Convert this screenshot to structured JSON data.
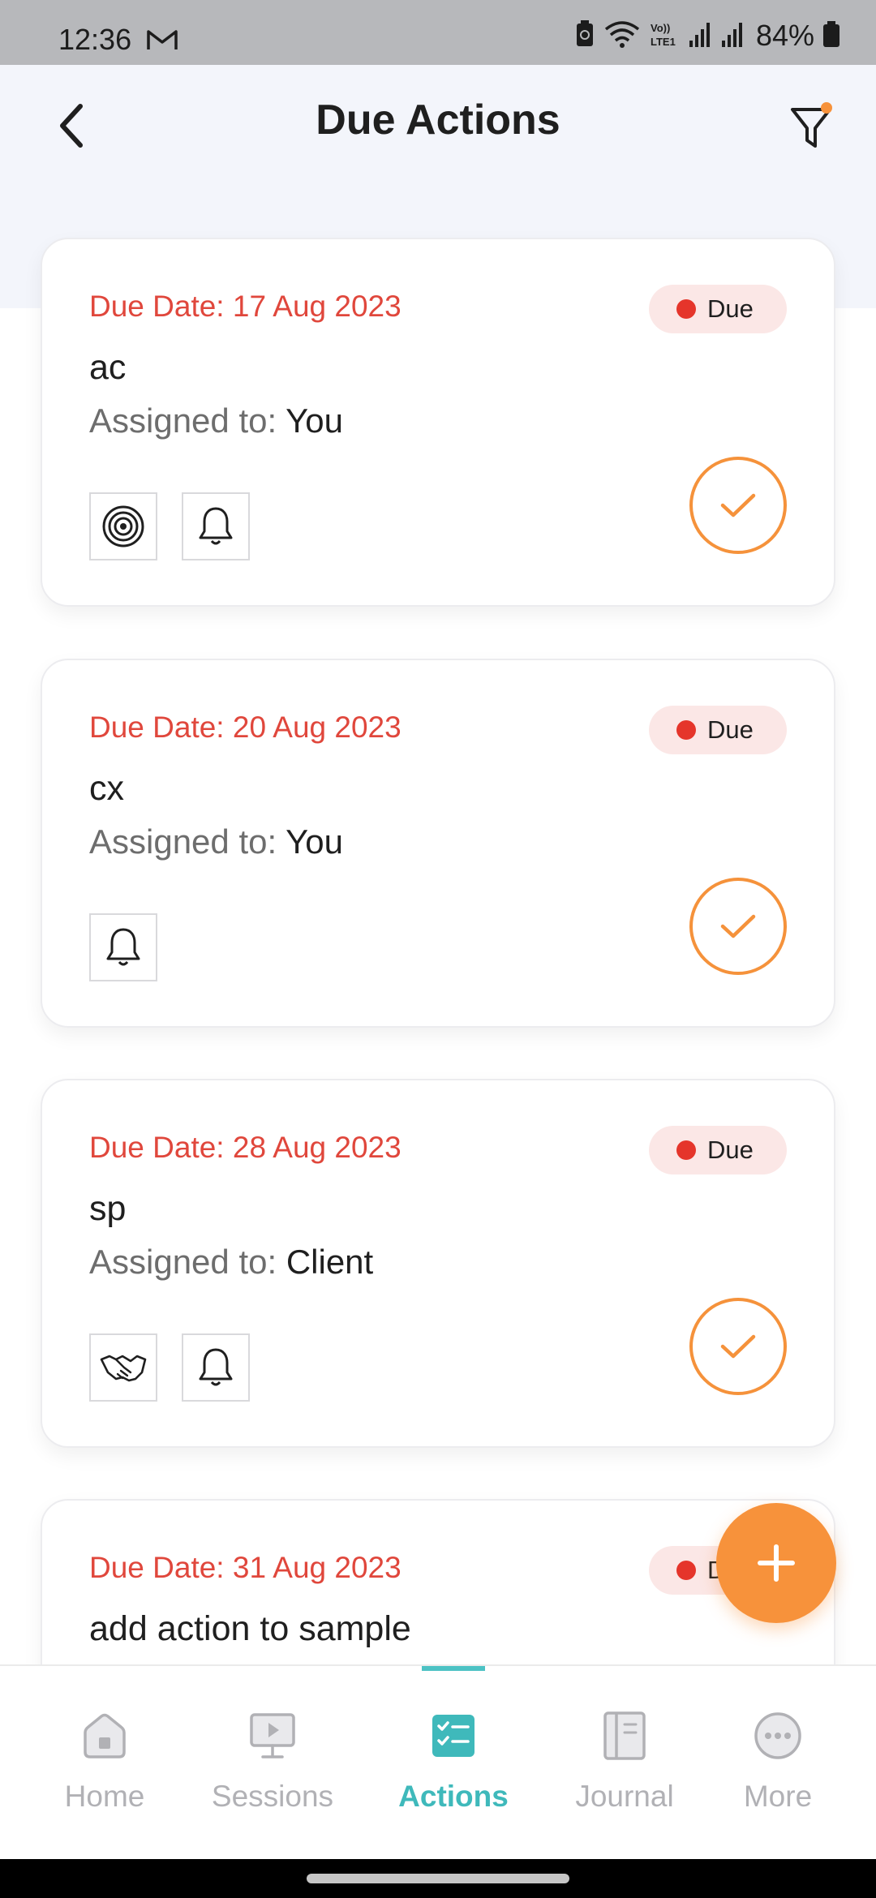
{
  "status_bar": {
    "time": "12:36",
    "battery": "84%"
  },
  "header": {
    "title": "Due Actions"
  },
  "actions": [
    {
      "due_date": "Due Date: 17 Aug 2023",
      "status": "Due",
      "title": "ac",
      "assigned_label": "Assigned to:",
      "assigned_to": "You",
      "icons": [
        "target-icon",
        "bell-icon"
      ]
    },
    {
      "due_date": "Due Date: 20 Aug 2023",
      "status": "Due",
      "title": "cx",
      "assigned_label": "Assigned to:",
      "assigned_to": "You",
      "icons": [
        "bell-icon"
      ]
    },
    {
      "due_date": "Due Date: 28 Aug 2023",
      "status": "Due",
      "title": "sp",
      "assigned_label": "Assigned to:",
      "assigned_to": "Client",
      "icons": [
        "handshake-icon",
        "bell-icon"
      ]
    },
    {
      "due_date": "Due Date: 31 Aug 2023",
      "status": "Due",
      "title": "add action to sample"
    }
  ],
  "nav": {
    "items": [
      {
        "label": "Home",
        "icon": "home-icon"
      },
      {
        "label": "Sessions",
        "icon": "sessions-icon"
      },
      {
        "label": "Actions",
        "icon": "actions-icon",
        "active": true
      },
      {
        "label": "Journal",
        "icon": "journal-icon"
      },
      {
        "label": "More",
        "icon": "more-icon"
      }
    ]
  },
  "colors": {
    "accent_orange": "#f7923b",
    "due_red": "#e0473c",
    "active_teal": "#3fb9bb",
    "inactive_gray": "#b1b1b5"
  }
}
